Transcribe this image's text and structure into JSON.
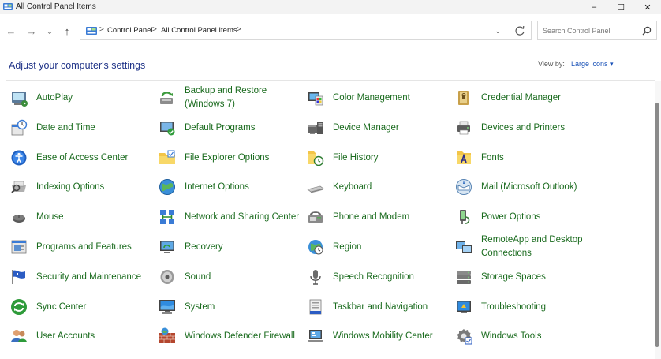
{
  "window": {
    "title": "All Control Panel Items",
    "minimize": "–",
    "maximize": "☐",
    "close": "✕"
  },
  "nav": {
    "back": "←",
    "forward": "→",
    "recent": "⌄",
    "up": "↑"
  },
  "address": {
    "crumbs": [
      "Control Panel",
      "All Control Panel Items"
    ],
    "separators": [
      ">",
      ">",
      ">"
    ],
    "dropdown": "⌄"
  },
  "search": {
    "placeholder": "Search Control Panel"
  },
  "header": {
    "title": "Adjust your computer's settings",
    "view_by_label": "View by:",
    "view_by_value": "Large icons ▾"
  },
  "colors": {
    "link": "#1a6b1e",
    "heading": "#1e3287",
    "accent": "#1b53b8"
  },
  "items": [
    {
      "label": "AutoPlay",
      "icon": "autoplay-icon"
    },
    {
      "label": "Backup and Restore (Windows 7)",
      "icon": "backup-restore-icon"
    },
    {
      "label": "Color Management",
      "icon": "color-management-icon"
    },
    {
      "label": "Credential Manager",
      "icon": "credential-manager-icon"
    },
    {
      "label": "Date and Time",
      "icon": "date-time-icon"
    },
    {
      "label": "Default Programs",
      "icon": "default-programs-icon"
    },
    {
      "label": "Device Manager",
      "icon": "device-manager-icon"
    },
    {
      "label": "Devices and Printers",
      "icon": "devices-printers-icon"
    },
    {
      "label": "Ease of Access Center",
      "icon": "ease-of-access-icon"
    },
    {
      "label": "File Explorer Options",
      "icon": "file-explorer-options-icon"
    },
    {
      "label": "File History",
      "icon": "file-history-icon"
    },
    {
      "label": "Fonts",
      "icon": "fonts-icon"
    },
    {
      "label": "Indexing Options",
      "icon": "indexing-options-icon"
    },
    {
      "label": "Internet Options",
      "icon": "internet-options-icon"
    },
    {
      "label": "Keyboard",
      "icon": "keyboard-icon"
    },
    {
      "label": "Mail (Microsoft Outlook)",
      "icon": "mail-icon"
    },
    {
      "label": "Mouse",
      "icon": "mouse-icon"
    },
    {
      "label": "Network and Sharing Center",
      "icon": "network-sharing-icon"
    },
    {
      "label": "Phone and Modem",
      "icon": "phone-modem-icon"
    },
    {
      "label": "Power Options",
      "icon": "power-options-icon"
    },
    {
      "label": "Programs and Features",
      "icon": "programs-features-icon"
    },
    {
      "label": "Recovery",
      "icon": "recovery-icon"
    },
    {
      "label": "Region",
      "icon": "region-icon"
    },
    {
      "label": "RemoteApp and Desktop Connections",
      "icon": "remoteapp-icon"
    },
    {
      "label": "Security and Maintenance",
      "icon": "security-maintenance-icon"
    },
    {
      "label": "Sound",
      "icon": "sound-icon"
    },
    {
      "label": "Speech Recognition",
      "icon": "speech-recognition-icon"
    },
    {
      "label": "Storage Spaces",
      "icon": "storage-spaces-icon"
    },
    {
      "label": "Sync Center",
      "icon": "sync-center-icon"
    },
    {
      "label": "System",
      "icon": "system-icon"
    },
    {
      "label": "Taskbar and Navigation",
      "icon": "taskbar-navigation-icon"
    },
    {
      "label": "Troubleshooting",
      "icon": "troubleshooting-icon"
    },
    {
      "label": "User Accounts",
      "icon": "user-accounts-icon"
    },
    {
      "label": "Windows Defender Firewall",
      "icon": "firewall-icon"
    },
    {
      "label": "Windows Mobility Center",
      "icon": "mobility-center-icon"
    },
    {
      "label": "Windows Tools",
      "icon": "windows-tools-icon"
    }
  ]
}
